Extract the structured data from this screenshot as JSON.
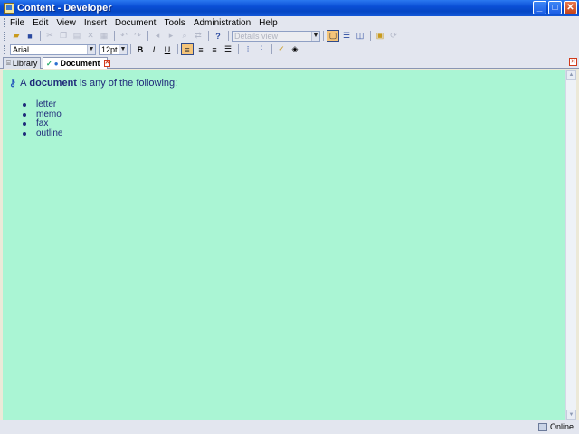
{
  "window": {
    "title": "Content - Developer"
  },
  "menu": {
    "items": [
      "File",
      "Edit",
      "View",
      "Insert",
      "Document",
      "Tools",
      "Administration",
      "Help"
    ]
  },
  "toolbar": {
    "view_combo": "Details view",
    "font_combo": "Arial",
    "size_combo": "12pt"
  },
  "tabs": {
    "library": "Library",
    "document": "Document"
  },
  "content": {
    "heading_prefix": "A",
    "heading_bold": "document",
    "heading_suffix": "is any of the following:",
    "items": [
      "letter",
      "memo",
      "fax",
      "outline"
    ]
  },
  "status": {
    "online": "Online"
  },
  "colors": {
    "content_bg": "#aaf5d4",
    "text": "#1f2a7a"
  }
}
